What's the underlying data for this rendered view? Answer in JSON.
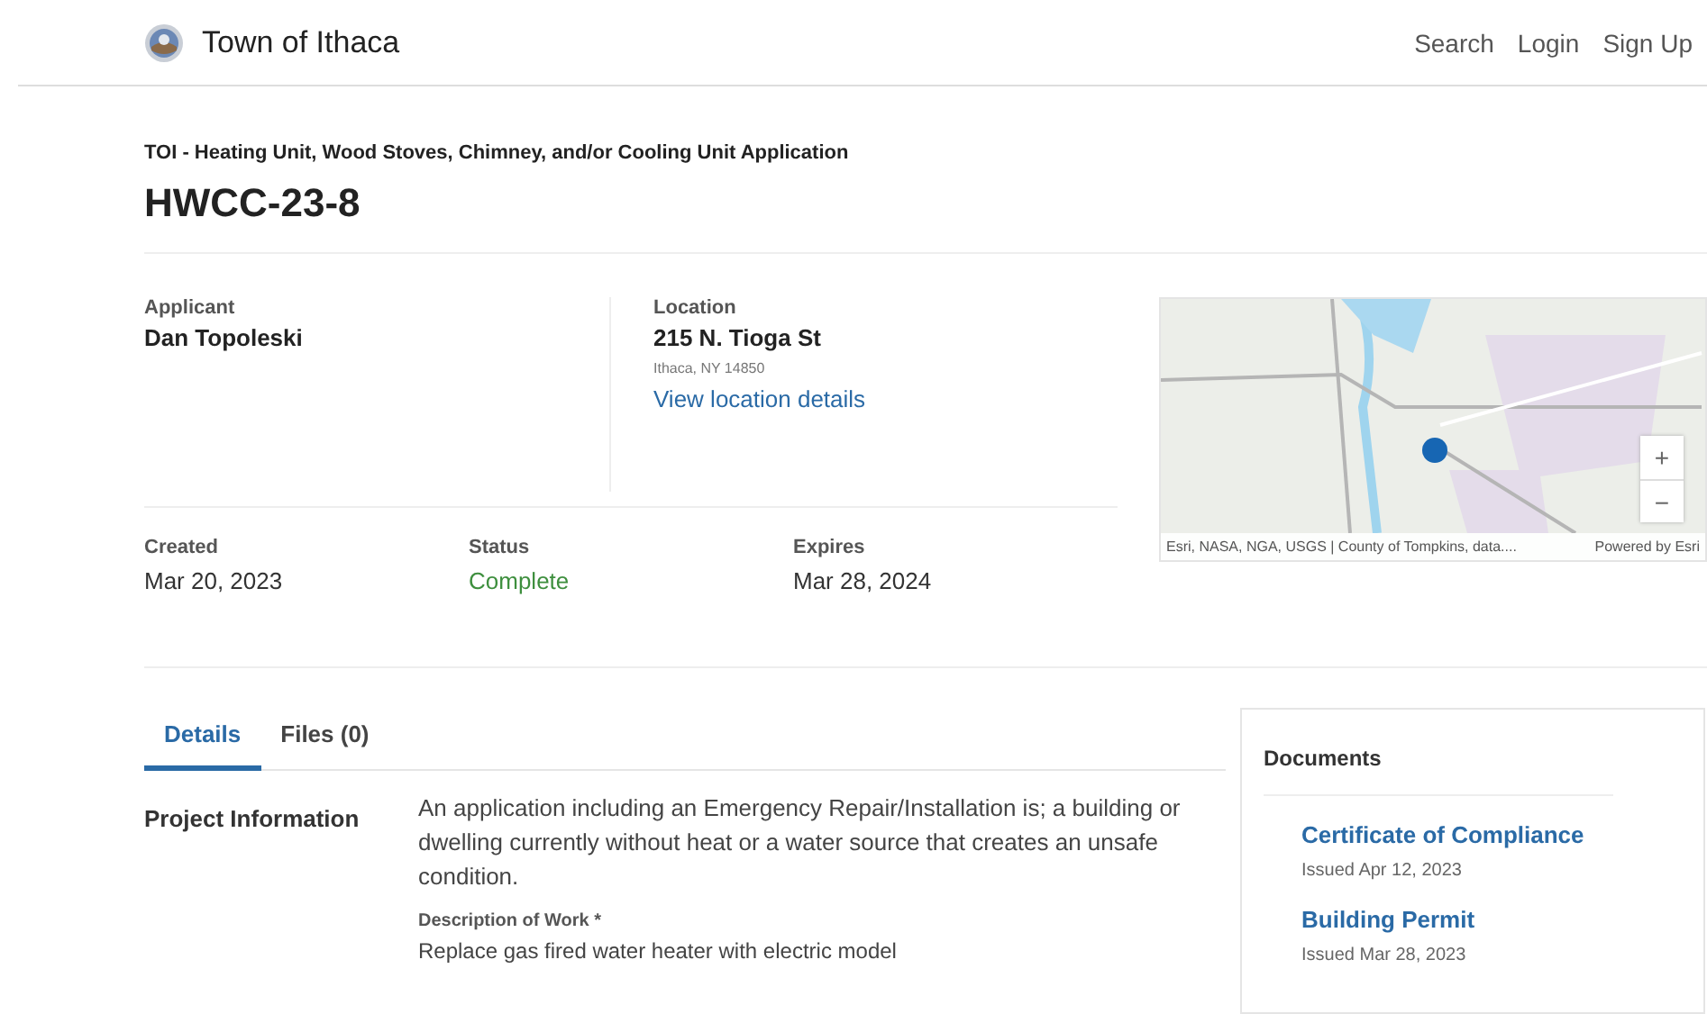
{
  "header": {
    "site_name": "Town of Ithaca",
    "nav": [
      {
        "label": "Search"
      },
      {
        "label": "Login"
      },
      {
        "label": "Sign Up"
      }
    ]
  },
  "record": {
    "type": "TOI - Heating Unit, Wood Stoves, Chimney, and/or Cooling Unit Application",
    "number": "HWCC-23-8"
  },
  "applicant": {
    "label": "Applicant",
    "name": "Dan Topoleski"
  },
  "location": {
    "label": "Location",
    "address": "215 N. Tioga St",
    "city": "Ithaca, NY 14850",
    "link": "View location details"
  },
  "dates": [
    {
      "label": "Created",
      "value": "Mar 20, 2023",
      "kind": "plain"
    },
    {
      "label": "Status",
      "value": "Complete",
      "kind": "status"
    },
    {
      "label": "Expires",
      "value": "Mar 28, 2024",
      "kind": "plain"
    }
  ],
  "map": {
    "attribution": "Esri, NASA, NGA, USGS | County of Tompkins, data....",
    "powered_by": "Powered by Esri",
    "zoom_in": "+",
    "zoom_out": "−"
  },
  "tabs": [
    {
      "label": "Details",
      "selected": true
    },
    {
      "label": "Files (0)",
      "selected": false
    }
  ],
  "details": {
    "section": "Project Information",
    "description": "An application including an Emergency Repair/Installation is; a building or dwelling currently without heat or a water source that creates an unsafe condition.",
    "field_label": "Description of Work *",
    "field_value": "Replace gas fired water heater with electric model"
  },
  "documents": {
    "title": "Documents",
    "items": [
      {
        "name": "Certificate of Compliance",
        "issued": "Issued Apr 12, 2023"
      },
      {
        "name": "Building Permit",
        "issued": "Issued Mar 28, 2023"
      }
    ]
  }
}
